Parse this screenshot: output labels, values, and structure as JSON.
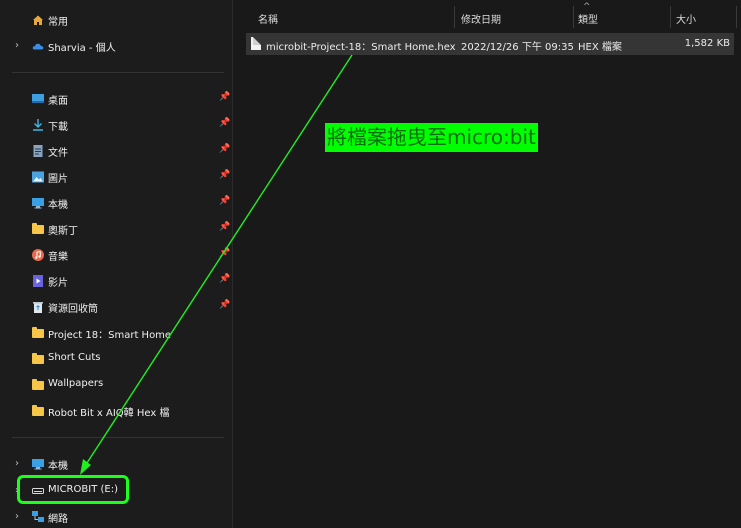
{
  "sidebar": {
    "home": "常用",
    "onedrive": "Sharvia - 個人",
    "pinned": [
      {
        "label": "桌面",
        "icon": "desktop-icon"
      },
      {
        "label": "下載",
        "icon": "download-icon"
      },
      {
        "label": "文件",
        "icon": "document-icon"
      },
      {
        "label": "圖片",
        "icon": "picture-icon"
      },
      {
        "label": "本機",
        "icon": "computer-icon"
      },
      {
        "label": "奧斯丁",
        "icon": "folder-icon"
      },
      {
        "label": "音樂",
        "icon": "music-icon"
      },
      {
        "label": "影片",
        "icon": "video-icon"
      },
      {
        "label": "資源回收筒",
        "icon": "recycle-bin-icon"
      }
    ],
    "folders": [
      "Project 18：Smart Home",
      "Short Cuts",
      "Wallpapers",
      "Robot Bit x AIQ韓 Hex 檔"
    ],
    "this_pc": "本機",
    "microbit": "MICROBIT (E:)",
    "network": "網路"
  },
  "columns": {
    "name": "名稱",
    "modified": "修改日期",
    "type": "類型",
    "size": "大小"
  },
  "file": {
    "name": "microbit-Project-18：Smart Home.hex",
    "modified": "2022/12/26 下午 09:35",
    "type": "HEX 檔案",
    "size": "1,582 KB"
  },
  "annotation": {
    "text": "將檔案拖曳至micro:bit",
    "color": "#00ff00",
    "arrow_color": "#22ee22"
  }
}
